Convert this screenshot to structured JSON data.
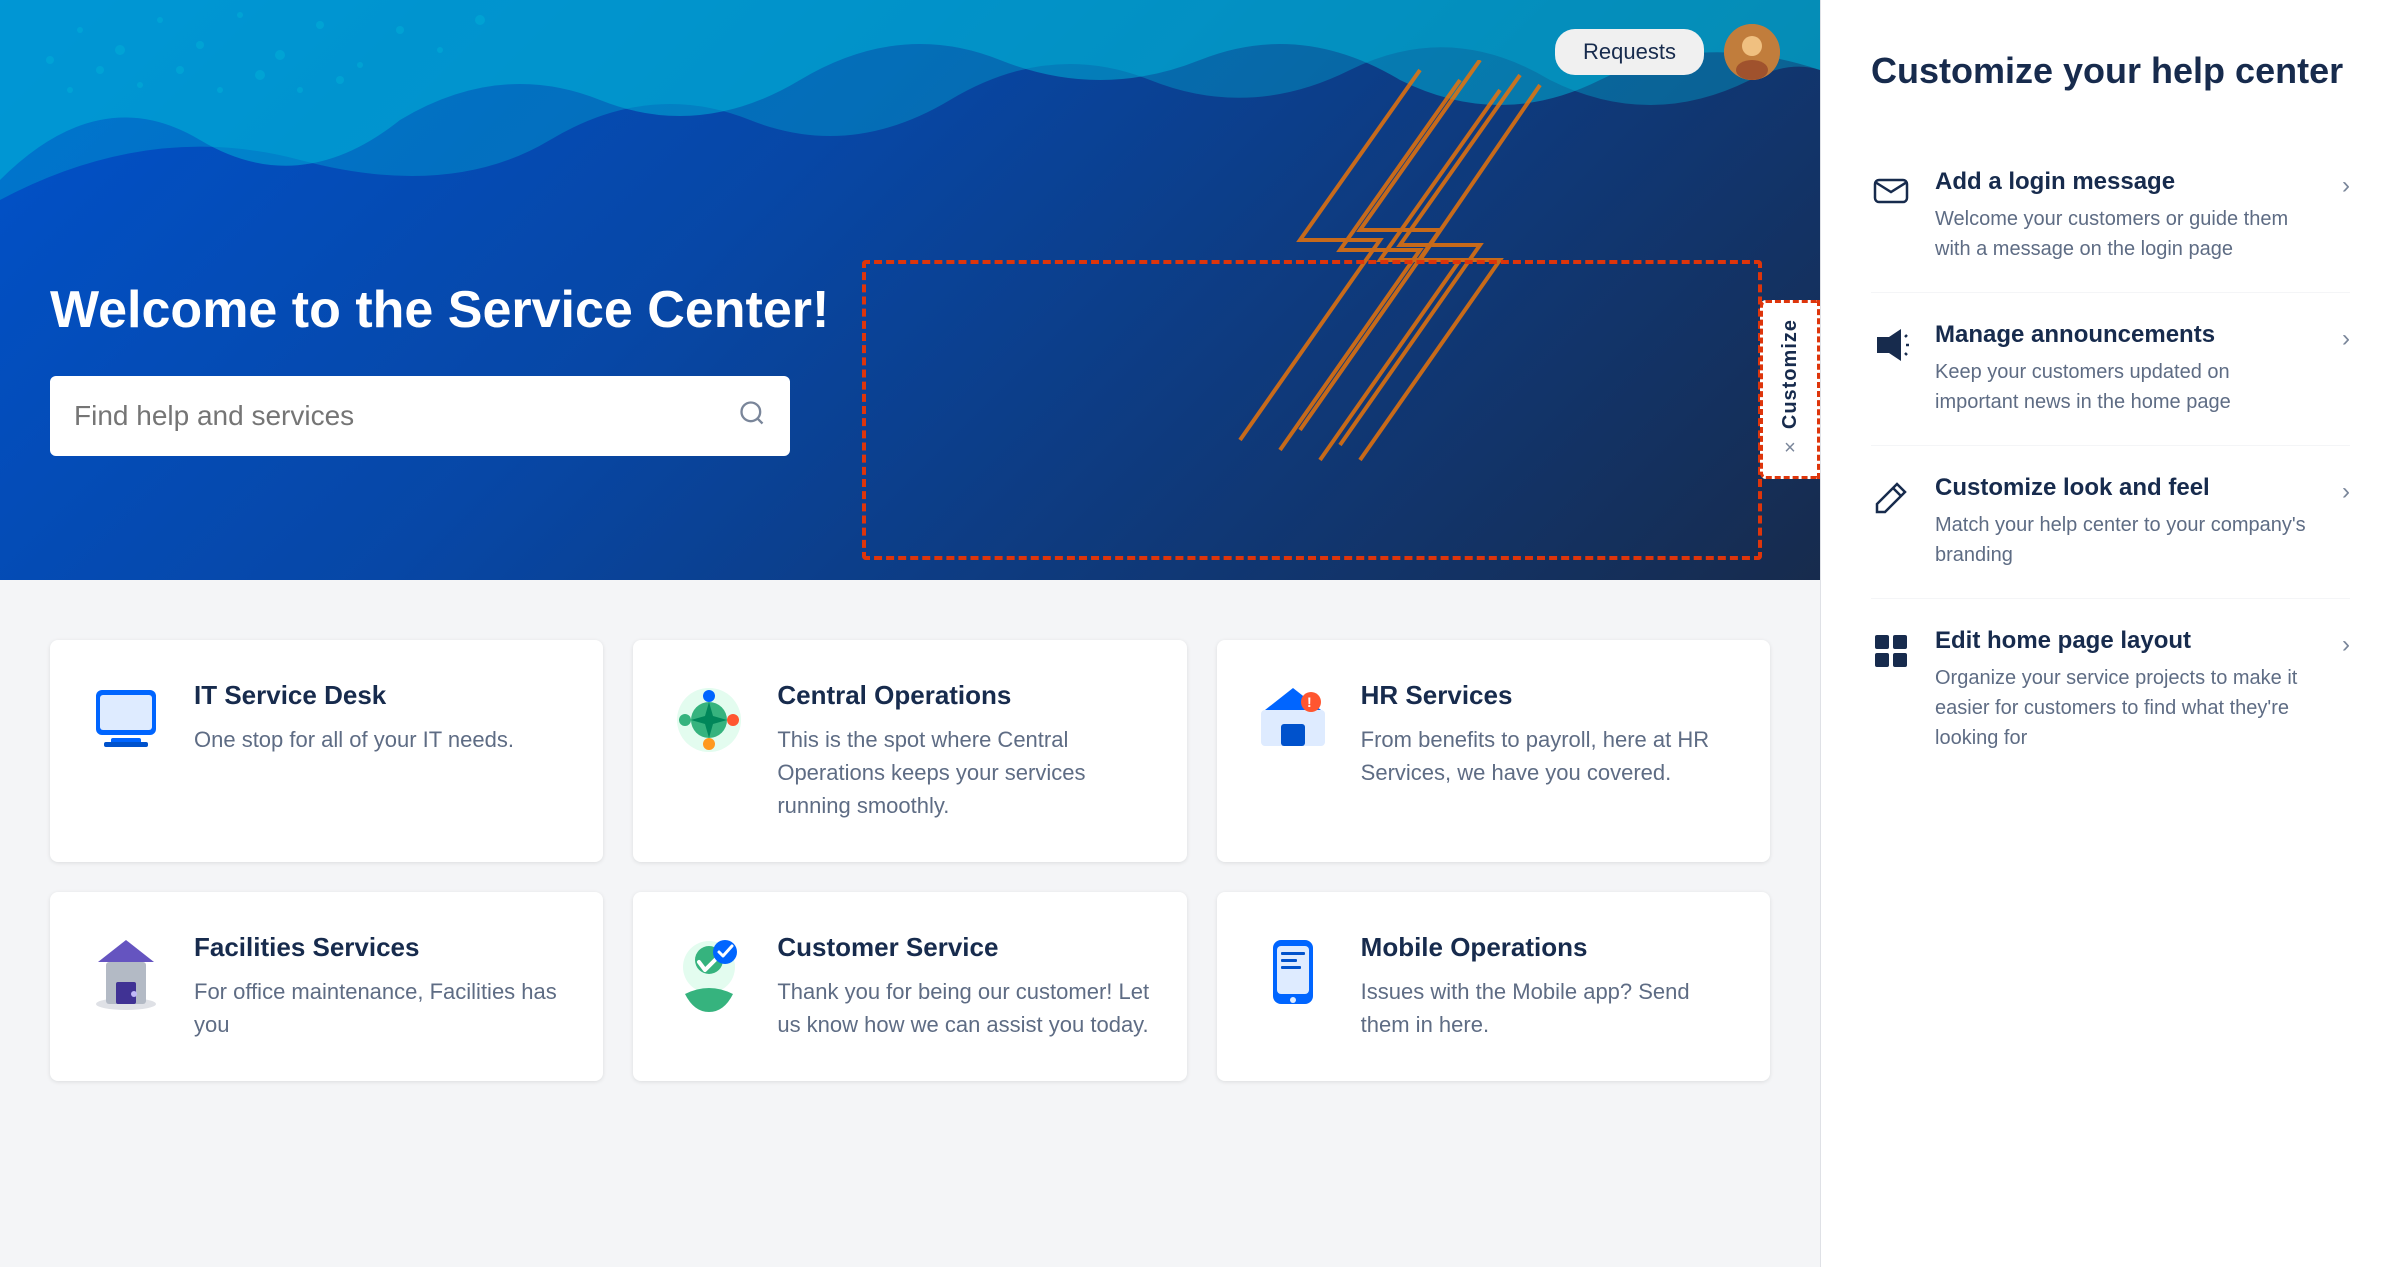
{
  "hero": {
    "title": "Welcome to the Service Center!",
    "search_placeholder": "Find help and services",
    "requests_label": "Requests"
  },
  "customize_tab": {
    "label": "Customize",
    "close": "×"
  },
  "cards": [
    {
      "id": "it-desk",
      "name": "IT Service Desk",
      "description": "One stop for all of your IT needs.",
      "partial": true
    },
    {
      "id": "central-ops",
      "name": "Central Operations",
      "description": "This is the spot where Central Operations keeps your services running smoothly.",
      "partial": false
    },
    {
      "id": "hr-services",
      "name": "HR Services",
      "description": "From benefits to payroll, here at HR Services, we have you covered.",
      "partial": false
    },
    {
      "id": "facilities",
      "name": "Facilities Services",
      "description": "For office maintenance, Facilities has you",
      "partial": true
    },
    {
      "id": "customer-service",
      "name": "Customer Service",
      "description": "Thank you for being our customer! Let us know how we can assist you today.",
      "partial": false
    },
    {
      "id": "mobile-ops",
      "name": "Mobile Operations",
      "description": "Issues with the Mobile app? Send them in here.",
      "partial": false
    }
  ],
  "panel": {
    "title": "Customize your help center",
    "items": [
      {
        "id": "login-message",
        "title": "Add a login message",
        "description": "Welcome your customers or guide them with a message on the login page"
      },
      {
        "id": "announcements",
        "title": "Manage announcements",
        "description": "Keep your customers updated on important news in the home page"
      },
      {
        "id": "look-feel",
        "title": "Customize look and feel",
        "description": "Match your help center to your company's branding"
      },
      {
        "id": "home-layout",
        "title": "Edit home page layout",
        "description": "Organize your service projects to make it easier for customers to find what they're looking for"
      }
    ]
  }
}
